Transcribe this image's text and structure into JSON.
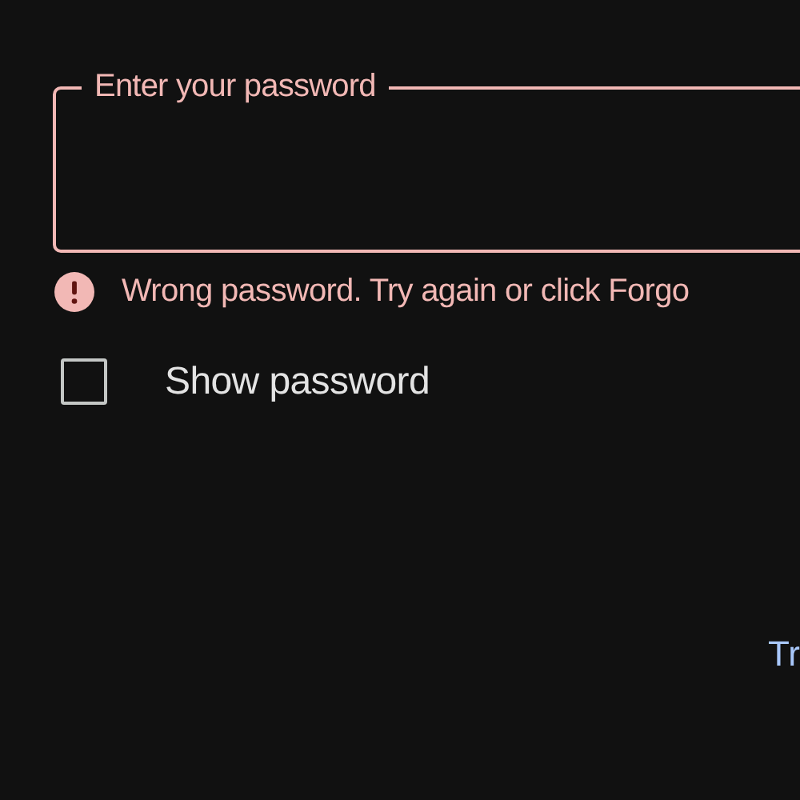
{
  "password_field": {
    "label": "Enter your password",
    "invalid": true
  },
  "error": {
    "message": "Wrong password. Try again or click Forgo"
  },
  "show_password": {
    "label": "Show password",
    "checked": false
  },
  "next_button": {
    "label": "Tr"
  }
}
